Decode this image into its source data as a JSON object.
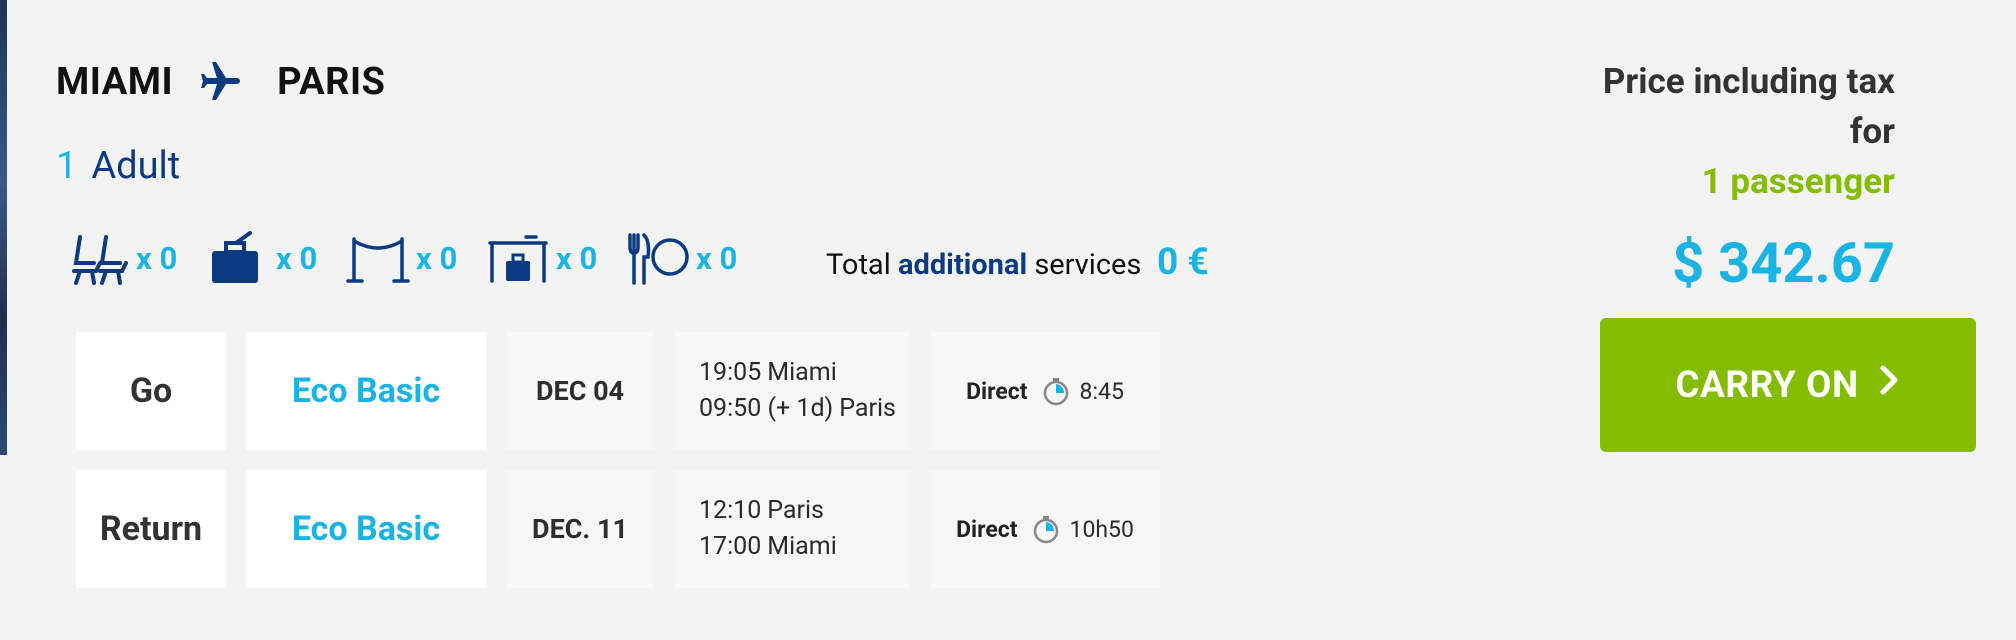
{
  "route": {
    "origin": "MIAMI",
    "destination": "PARIS"
  },
  "passengers": {
    "count": "1",
    "label": "Adult"
  },
  "services": [
    {
      "icon": "seat-icon",
      "qty": "x 0"
    },
    {
      "icon": "luggage-icon",
      "qty": "x 0"
    },
    {
      "icon": "lounge-icon",
      "qty": "x 0"
    },
    {
      "icon": "priority-baggage-icon",
      "qty": "x 0"
    },
    {
      "icon": "meal-icon",
      "qty": "x 0"
    }
  ],
  "additional_total": {
    "prefix": "Total",
    "highlight": "additional",
    "suffix": "services",
    "value": "0 €"
  },
  "flights": [
    {
      "direction": "Go",
      "fare": "Eco Basic",
      "date": "DEC 04",
      "dep_time": "19:05",
      "dep_place": "Miami",
      "arr_time": "09:50 (+ 1d)",
      "arr_place": "Paris",
      "type": "Direct",
      "duration": "8:45"
    },
    {
      "direction": "Return",
      "fare": "Eco Basic",
      "date": "DEC. 11",
      "dep_time": "12:10",
      "dep_place": "Paris",
      "arr_time": "17:00",
      "arr_place": "Miami",
      "type": "Direct",
      "duration": "10h50"
    }
  ],
  "price": {
    "line1": "Price including tax",
    "line2": "for",
    "line3": "1 passenger",
    "amount": "$ 342.67"
  },
  "cta": {
    "label": "CARRY ON"
  },
  "colors": {
    "accent": "#1ab3e6",
    "navy": "#0a3b82",
    "green": "#84bd00",
    "background": "#f3f3f3"
  }
}
